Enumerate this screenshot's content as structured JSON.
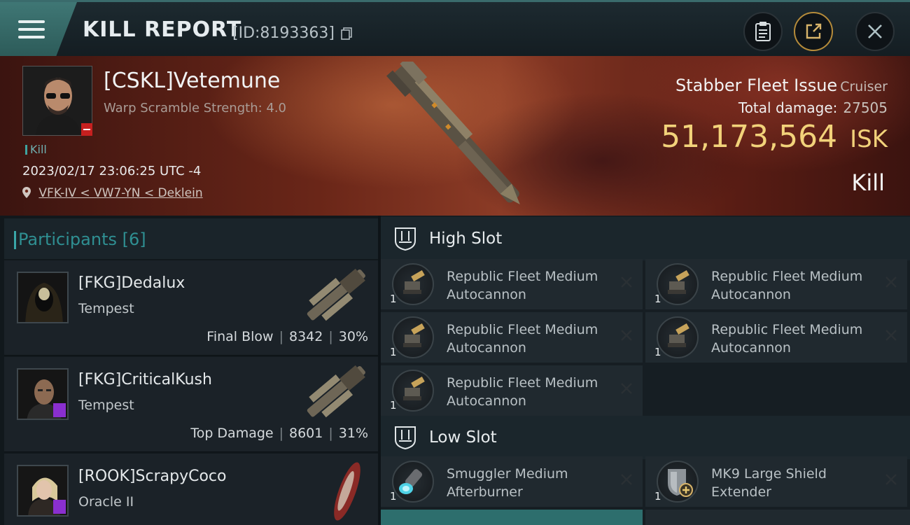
{
  "header": {
    "title": "KILL REPORT",
    "report_id": "[ID:8193363]",
    "buttons": [
      "clipboard",
      "share",
      "close"
    ]
  },
  "victim": {
    "name": "[CSKL]Vetemune",
    "warp_scramble": "Warp Scramble Strength: 4.0",
    "tag": "Kill",
    "datetime": "2023/02/17 23:06:25 UTC -4",
    "location": "VFK-IV < VW7-YN < Deklein",
    "ship_name": "Stabber Fleet Issue",
    "ship_class": "Cruiser",
    "total_damage_label": "Total damage:",
    "total_damage": "27505",
    "isk_value": "51,173,564",
    "isk_unit": "ISK",
    "result": "Kill"
  },
  "participants": {
    "label": "Participants",
    "count": "[6]",
    "list": [
      {
        "name": "[FKG]Dedalux",
        "ship": "Tempest",
        "role": "Final Blow",
        "damage": "8342",
        "percent": "30%"
      },
      {
        "name": "[FKG]CriticalKush",
        "ship": "Tempest",
        "role": "Top Damage",
        "damage": "8601",
        "percent": "31%"
      },
      {
        "name": "[ROOK]ScrapyCoco",
        "ship": "Oracle II"
      }
    ]
  },
  "slots": {
    "high": {
      "title": "High Slot",
      "modules": [
        {
          "name": "Republic Fleet Medium Autocannon",
          "qty": "1"
        },
        {
          "name": "Republic Fleet Medium Autocannon",
          "qty": "1"
        },
        {
          "name": "Republic Fleet Medium Autocannon",
          "qty": "1"
        },
        {
          "name": "Republic Fleet Medium Autocannon",
          "qty": "1"
        },
        {
          "name": "Republic Fleet Medium Autocannon",
          "qty": "1"
        }
      ]
    },
    "low": {
      "title": "Low Slot",
      "modules": [
        {
          "name": "Smuggler Medium Afterburner",
          "qty": "1"
        },
        {
          "name": "MK9 Large Shield Extender",
          "qty": "1"
        }
      ]
    }
  }
}
